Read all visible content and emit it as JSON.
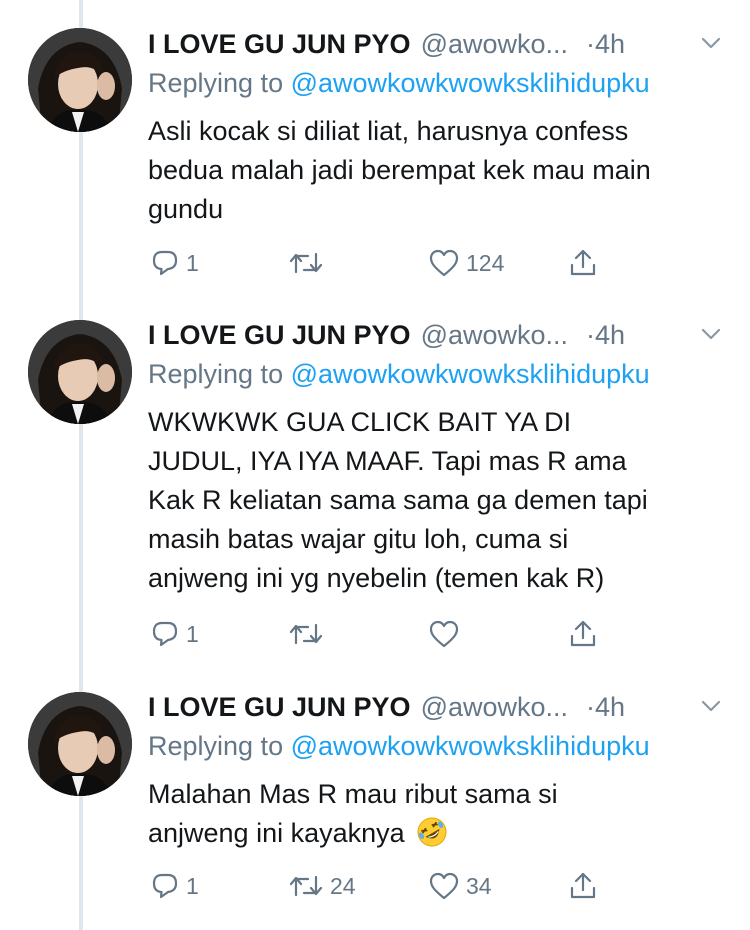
{
  "tweets": [
    {
      "display_name": "I LOVE GU JUN PYO",
      "handle": "@awowko...",
      "time": "·4h",
      "replying_prefix": "Replying to ",
      "replying_handle": "@awowkowkwowksklihidupku",
      "lines": [
        "Asli kocak si diliat liat, harusnya confess",
        "bedua malah jadi berempat kek mau main",
        "gundu"
      ],
      "counts": {
        "reply": "1",
        "retweet": "",
        "like": "124"
      }
    },
    {
      "display_name": "I LOVE GU JUN PYO",
      "handle": "@awowko...",
      "time": "·4h",
      "replying_prefix": "Replying to ",
      "replying_handle": "@awowkowkwowksklihidupku",
      "lines": [
        "WKWKWK GUA CLICK BAIT YA DI",
        "JUDUL, IYA IYA MAAF. Tapi mas R ama",
        "Kak R keliatan sama sama ga demen tapi",
        "masih batas wajar gitu loh, cuma si",
        "anjweng ini yg nyebelin (temen kak R)"
      ],
      "counts": {
        "reply": "1",
        "retweet": "",
        "like": ""
      }
    },
    {
      "display_name": "I LOVE GU JUN PYO",
      "handle": "@awowko...",
      "time": "·4h",
      "replying_prefix": "Replying to ",
      "replying_handle": "@awowkowkwowksklihidupku",
      "lines": [
        "Malahan Mas R mau ribut sama si",
        "anjweng ini kayaknya"
      ],
      "emoji": "rolling-on-floor-laughing-emoji",
      "counts": {
        "reply": "1",
        "retweet": "24",
        "like": "34"
      }
    }
  ],
  "colors": {
    "text": "#14171a",
    "secondary": "#657786",
    "accent": "#1da1f2",
    "thread_line": "#e1e8ed"
  }
}
